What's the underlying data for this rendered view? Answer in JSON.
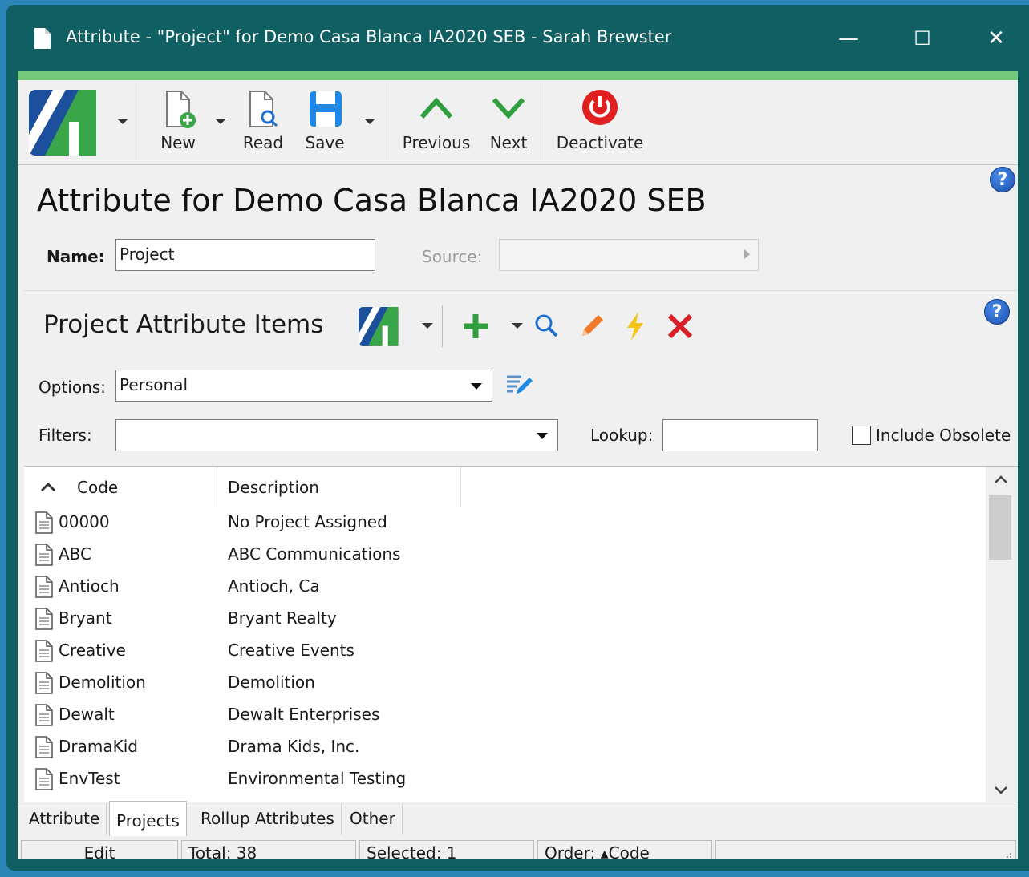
{
  "window": {
    "title": "Attribute - \"Project\" for Demo Casa Blanca IA2020 SEB - Sarah Brewster",
    "minimize": "—",
    "maximize": "☐",
    "close": "✕"
  },
  "toolbar": {
    "new": "New",
    "read": "Read",
    "save": "Save",
    "previous": "Previous",
    "next": "Next",
    "deactivate": "Deactivate"
  },
  "page": {
    "title": "Attribute for Demo Casa Blanca IA2020 SEB",
    "name_label": "Name:",
    "name_value": "Project",
    "source_label": "Source:",
    "source_value": ""
  },
  "items_panel": {
    "title": "Project Attribute Items",
    "options_label": "Options:",
    "options_value": "Personal",
    "filters_label": "Filters:",
    "filters_value": "",
    "lookup_label": "Lookup:",
    "lookup_value": "",
    "include_obsolete_label": "Include Obsolete",
    "include_obsolete_checked": false
  },
  "grid": {
    "columns": [
      "Code",
      "Description"
    ],
    "rows": [
      {
        "code": "00000",
        "description": "No Project Assigned"
      },
      {
        "code": "ABC",
        "description": "ABC Communications"
      },
      {
        "code": "Antioch",
        "description": "Antioch, Ca"
      },
      {
        "code": "Bryant",
        "description": "Bryant Realty"
      },
      {
        "code": "Creative",
        "description": "Creative Events"
      },
      {
        "code": "Demolition",
        "description": "Demolition"
      },
      {
        "code": "Dewalt",
        "description": "Dewalt Enterprises"
      },
      {
        "code": "DramaKid",
        "description": "Drama Kids, Inc."
      },
      {
        "code": "EnvTest",
        "description": "Environmental Testing"
      }
    ]
  },
  "tabs": [
    {
      "label": "Attribute",
      "active": false
    },
    {
      "label": "Projects",
      "active": true
    },
    {
      "label": "Rollup Attributes",
      "active": false
    },
    {
      "label": "Other",
      "active": false
    }
  ],
  "status": {
    "mode": "Edit",
    "total": "Total: 38",
    "selected": "Selected: 1",
    "order": "Order: ▴Code",
    "extra": ""
  },
  "colors": {
    "titlebar": "#0f5f63",
    "accent_green": "#74c97a",
    "desktop": "#2d86b8"
  }
}
